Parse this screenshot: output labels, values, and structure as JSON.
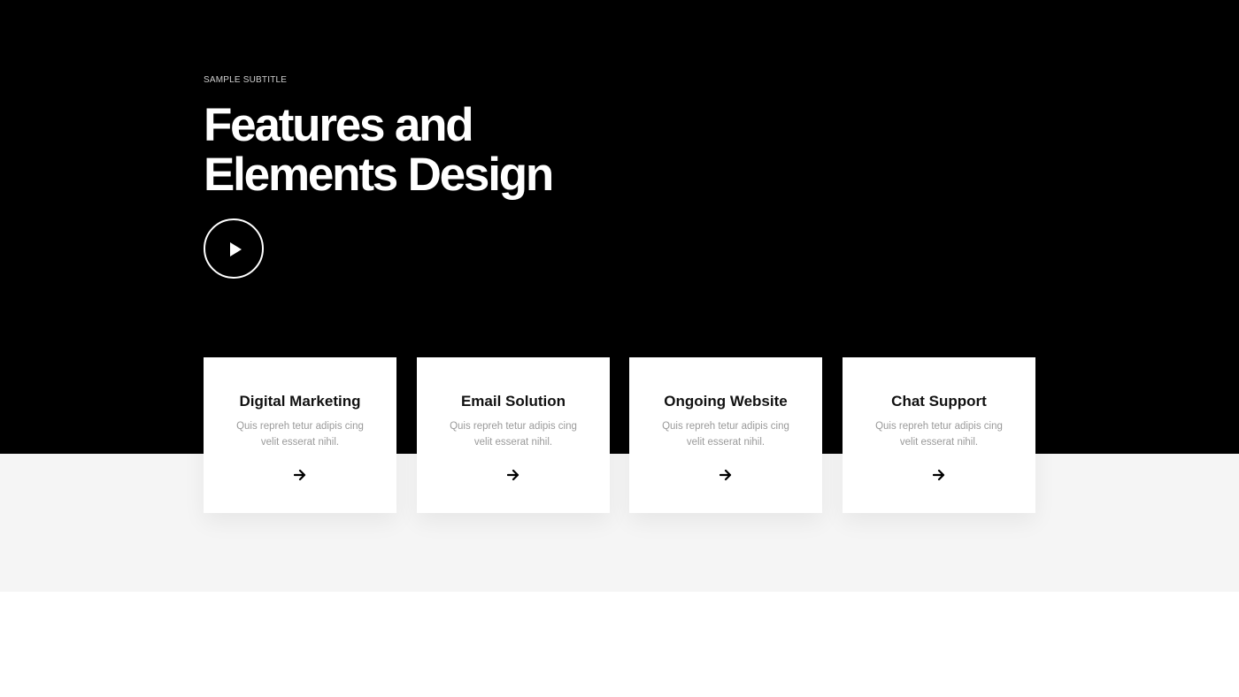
{
  "hero": {
    "subtitle": "SAMPLE SUBTITLE",
    "title": "Features and Elements Design",
    "play_icon": "play-icon"
  },
  "cards": [
    {
      "title": "Digital Marketing",
      "text": "Quis repreh tetur adipis cing velit esserat nihil.",
      "icon": "arrow-right-icon"
    },
    {
      "title": "Email Solution",
      "text": "Quis repreh tetur adipis cing velit esserat nihil.",
      "icon": "arrow-right-icon"
    },
    {
      "title": "Ongoing Website",
      "text": "Quis repreh tetur adipis cing velit esserat nihil.",
      "icon": "arrow-right-icon"
    },
    {
      "title": "Chat Support",
      "text": "Quis repreh tetur adipis cing velit esserat nihil.",
      "icon": "arrow-right-icon"
    }
  ],
  "colors": {
    "hero_background": "#000000",
    "band_background": "#f5f5f5",
    "card_background": "#ffffff",
    "title_text": "#ffffff",
    "card_title_text": "#111111",
    "card_body_text": "#9a9a9a"
  }
}
